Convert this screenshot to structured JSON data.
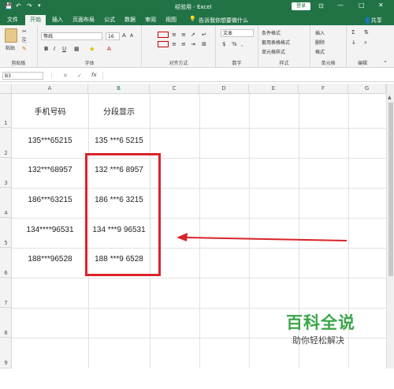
{
  "title": {
    "qat_save": "💾",
    "window_title": "经验用 - Excel",
    "login_label": "登录",
    "box_icon": "⊡",
    "minimize": "—",
    "restore": "□",
    "close": "✕"
  },
  "tabs": [
    "文件",
    "开始",
    "插入",
    "页面布局",
    "公式",
    "数据",
    "审阅",
    "视图"
  ],
  "tell_me": "告诉我你想要做什么",
  "share": "共享",
  "ribbon": {
    "clipboard": {
      "paste": "粘贴",
      "label": "剪贴板"
    },
    "font": {
      "name": "等线",
      "size": "16",
      "bold": "B",
      "italic": "I",
      "underline": "U",
      "grow": "A",
      "shrink": "A",
      "label": "字体"
    },
    "alignment": {
      "label": "对齐方式"
    },
    "number": {
      "format": "文本",
      "label": "数字"
    },
    "styles": {
      "conditional": "条件格式",
      "table": "套用表格格式",
      "cell": "单元格样式",
      "label": "样式"
    },
    "cells": {
      "insert": "插入",
      "delete": "删除",
      "format": "格式",
      "label": "单元格"
    },
    "editing": {
      "label": "编辑"
    }
  },
  "formula_bar": {
    "name_box": "B3",
    "cancel": "✕",
    "confirm": "✓",
    "fx": "fx",
    "value": ""
  },
  "columns": [
    "A",
    "B",
    "C",
    "D",
    "E",
    "F",
    "G"
  ],
  "rows": [
    "1",
    "2",
    "3",
    "4",
    "5",
    "6",
    "7",
    "8",
    "9"
  ],
  "sheet": {
    "header_a": "手机号码",
    "header_b": "分段显示",
    "col_a": [
      "135***65215",
      "132***68957",
      "186***63215",
      "134****96531",
      "188***96528"
    ],
    "col_b": [
      "135 ***6 5215",
      "132 ***6 8957",
      "186 ***6 3215",
      "134 ***9 96531",
      "188 ***9 6528"
    ]
  },
  "watermark": {
    "title": "百科全说",
    "subtitle": "助你轻松解决"
  },
  "colors": {
    "excel_green": "#217346",
    "highlight_red": "#d9232b",
    "watermark_green": "#3aa64a"
  }
}
